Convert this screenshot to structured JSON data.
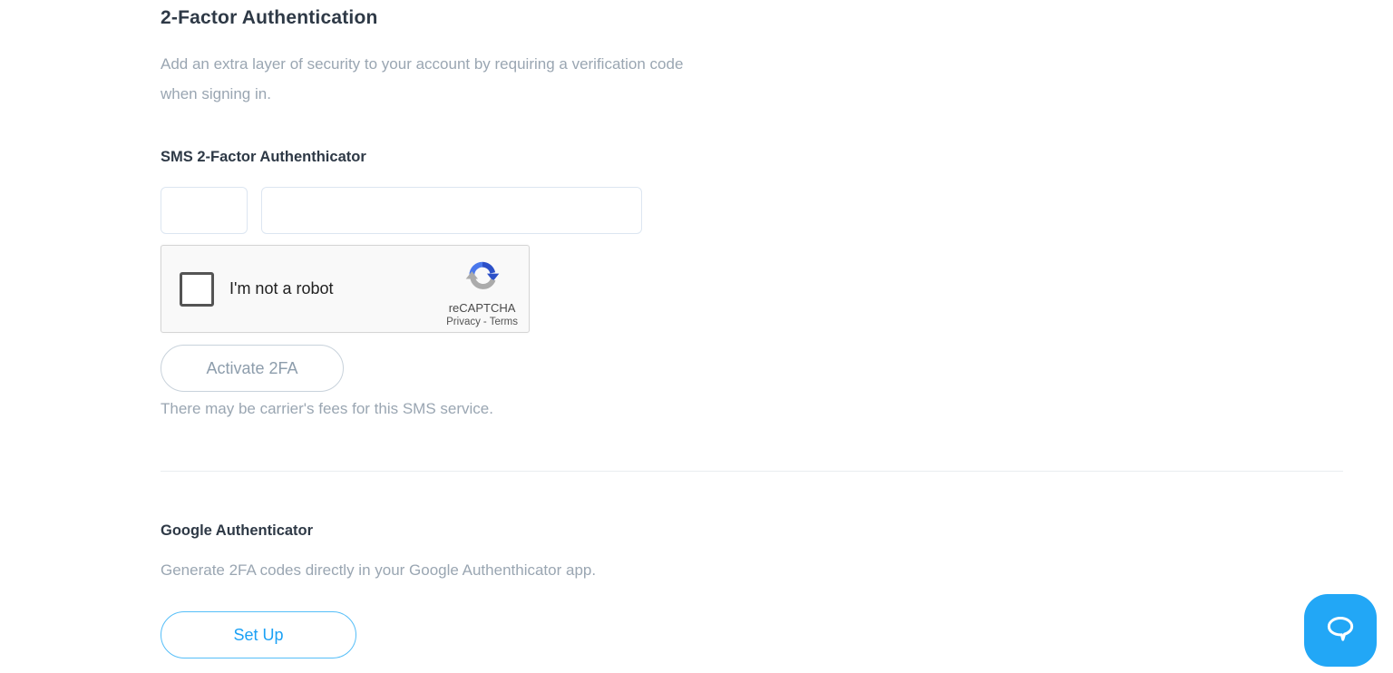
{
  "header": {
    "title": "2-Factor Authentication",
    "description": "Add an extra layer of security to your account by requiring a verification code when signing in."
  },
  "sms_section": {
    "heading": "SMS 2-Factor Authenthicator",
    "country_code_input": {
      "value": "",
      "placeholder": ""
    },
    "phone_input": {
      "value": "",
      "placeholder": ""
    },
    "activate_button_label": "Activate 2FA",
    "note": "There may be carrier's fees for this SMS service."
  },
  "recaptcha": {
    "checkbox_label": "I'm not a robot",
    "brand": "reCAPTCHA",
    "privacy_link": "Privacy",
    "link_separator": "-",
    "terms_link": "Terms"
  },
  "google_section": {
    "heading": "Google Authenticator",
    "description": "Generate 2FA codes directly in your Google Authenthicator app.",
    "setup_button_label": "Set Up"
  },
  "chat": {
    "icon": "speech-bubble-icon"
  },
  "colors": {
    "heading_text": "#2e3946",
    "body_text": "#9aa6b2",
    "input_border": "#dce6f1",
    "divider": "#e9edf0",
    "activate_border": "#c8d2db",
    "activate_text": "#8d9dac",
    "setup_border": "#55bef8",
    "setup_text": "#1ba1f5",
    "chat_blue": "#22a7f6",
    "recaptcha_bg": "#f9f9f9",
    "recaptcha_border": "#d5d5d5",
    "recaptcha_blue": "#3e67e0",
    "recaptcha_dark_blue": "#2c50c8",
    "recaptcha_gray": "#ababab"
  }
}
